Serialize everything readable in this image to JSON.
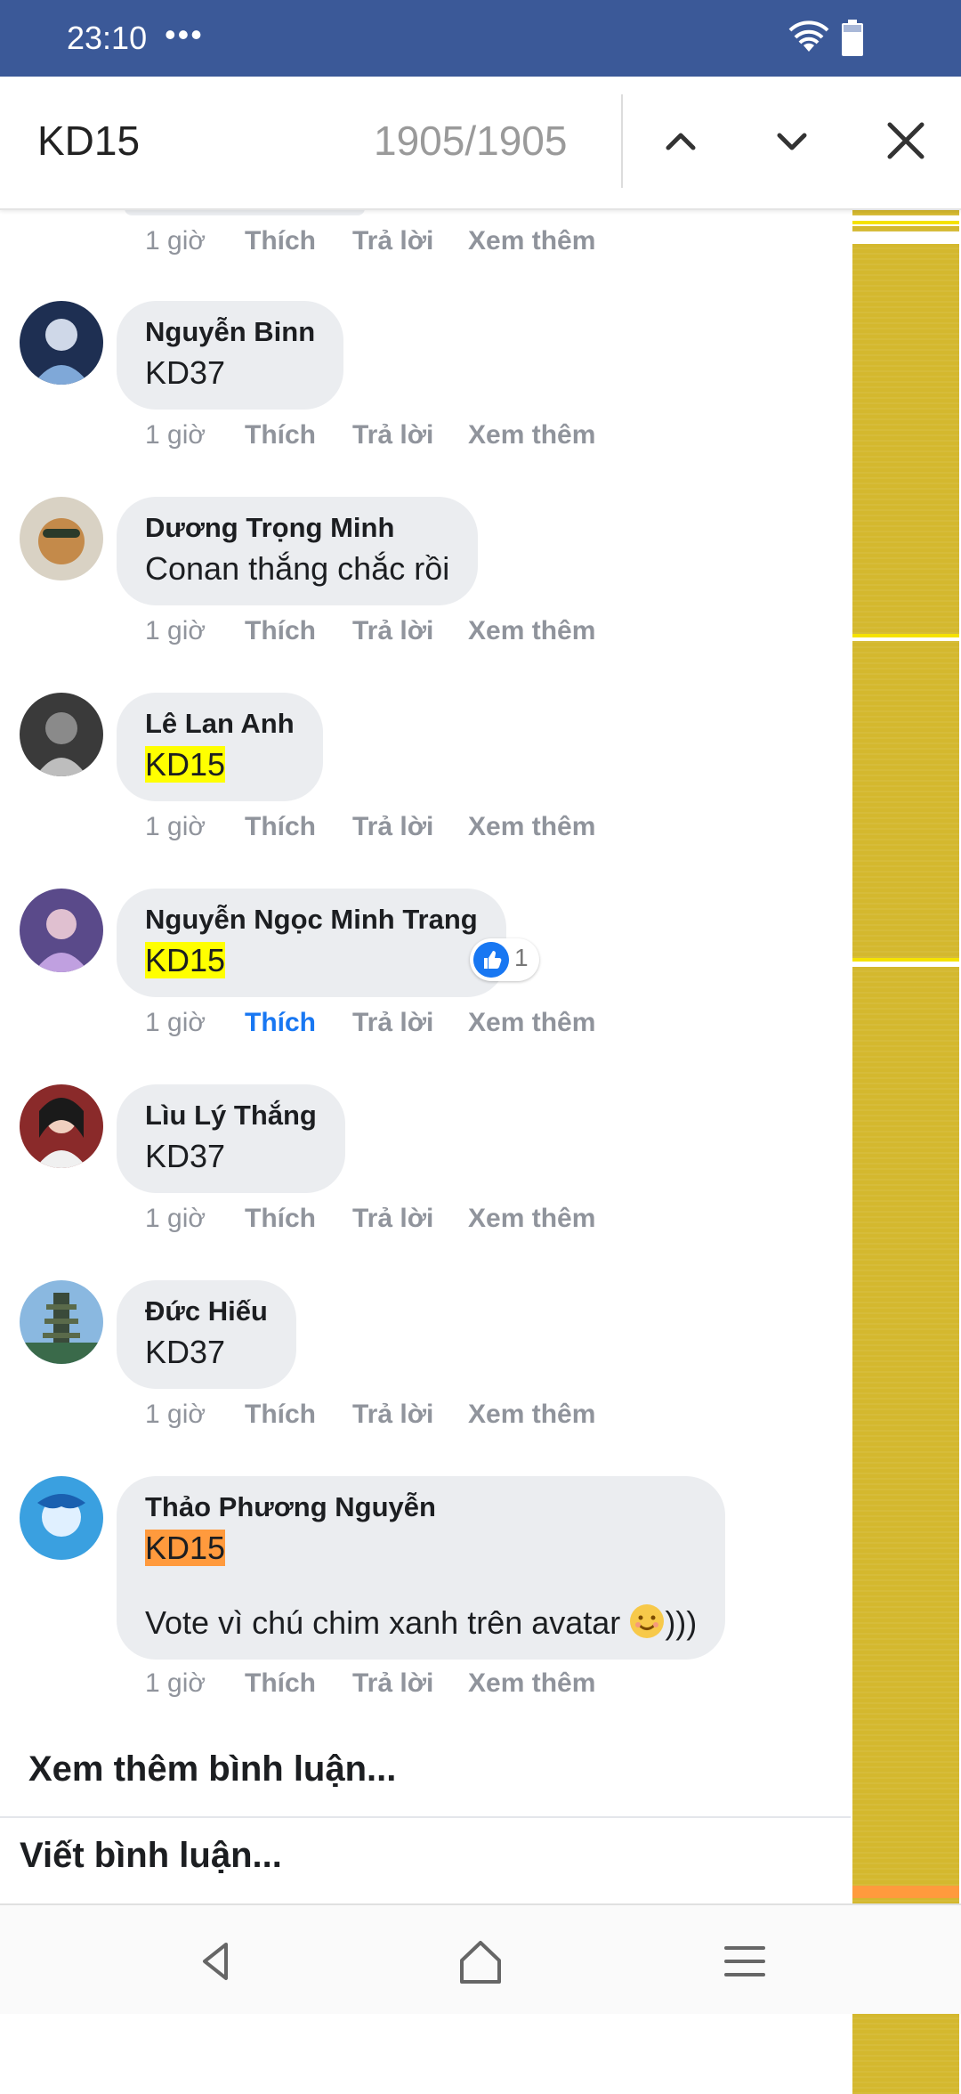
{
  "status_bar": {
    "time": "23:10",
    "dots": "•••"
  },
  "find_bar": {
    "query": "KD15",
    "match_count": "1905/1905"
  },
  "comments": [
    {
      "author": "Nguyễn Binn",
      "text": "KD37",
      "time": "1 giờ",
      "like": "Thích",
      "reply": "Trả lời",
      "more": "Xem thêm"
    },
    {
      "author": "Dương Trọng Minh",
      "text": "Conan thắng chắc rồi",
      "time": "1 giờ",
      "like": "Thích",
      "reply": "Trả lời",
      "more": "Xem thêm"
    },
    {
      "author": "Lê Lan Anh",
      "text": "KD15",
      "time": "1 giờ",
      "like": "Thích",
      "reply": "Trả lời",
      "more": "Xem thêm"
    },
    {
      "author": "Nguyễn Ngọc Minh Trang",
      "text": "KD15",
      "time": "1 giờ",
      "like": "Thích",
      "reply": "Trả lời",
      "more": "Xem thêm",
      "reaction_count": "1"
    },
    {
      "author": "Lìu Lý Thắng",
      "text": "KD37",
      "time": "1 giờ",
      "like": "Thích",
      "reply": "Trả lời",
      "more": "Xem thêm"
    },
    {
      "author": "Đức Hiếu",
      "text": "KD37",
      "time": "1 giờ",
      "like": "Thích",
      "reply": "Trả lời",
      "more": "Xem thêm"
    },
    {
      "author": "Thảo Phương Nguyễn",
      "text": "KD15",
      "text2": "Vote vì chú chim xanh trên avatar",
      "text2_suffix": ")))",
      "time": "1 giờ",
      "like": "Thích",
      "reply": "Trả lời",
      "more": "Xem thêm"
    }
  ],
  "top_actions": {
    "time": "1 giờ",
    "like": "Thích",
    "reply": "Trả lời",
    "more": "Xem thêm"
  },
  "footer": {
    "more_comments": "Xem thêm bình luận...",
    "write_comment": "Viết bình luận..."
  },
  "colors": {
    "header": "#3b5998",
    "highlight": "#ffff00",
    "current_match": "#ff9a3d",
    "liked": "#1877f2",
    "scroll_marker": "#d4b82e"
  },
  "icons": [
    "wifi-icon",
    "battery-icon",
    "chevron-up-icon",
    "chevron-down-icon",
    "close-icon",
    "thumbs-up-icon",
    "smile-emoji-icon",
    "back-icon",
    "home-icon",
    "menu-icon"
  ]
}
